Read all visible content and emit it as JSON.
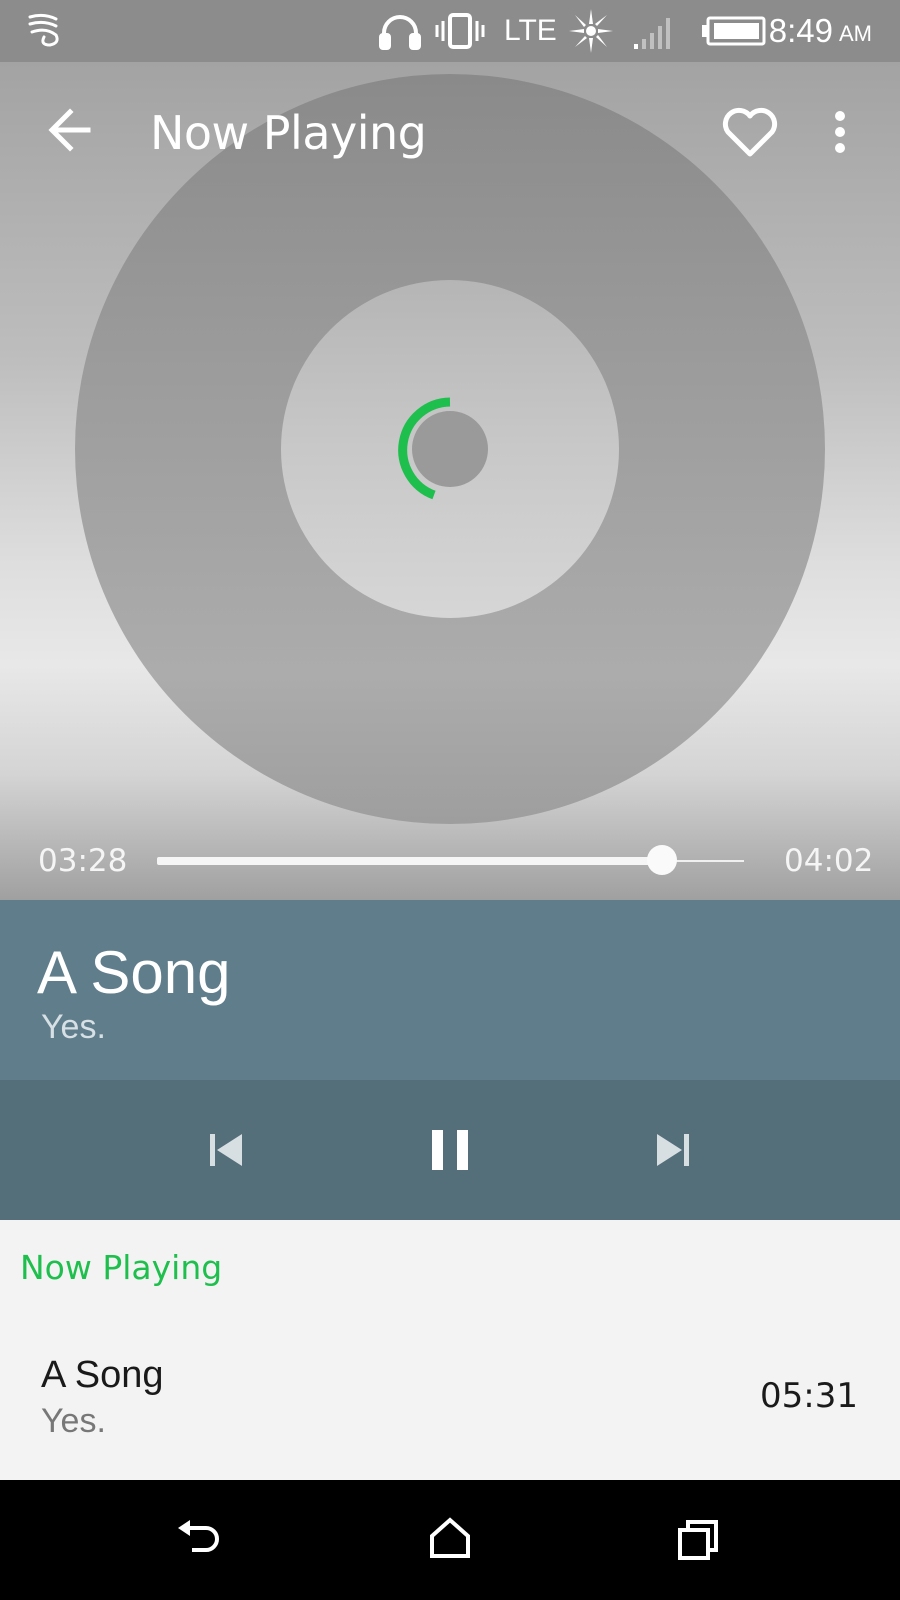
{
  "status_bar": {
    "network_type": "LTE",
    "time": "8:49",
    "ampm": "AM",
    "icons": [
      "notification-swirl-icon",
      "headphones-icon",
      "vibrate-icon",
      "brightness-icon",
      "signal-icon",
      "battery-icon"
    ]
  },
  "app_bar": {
    "title": "Now Playing",
    "back_icon": "arrow-left-icon",
    "favorite_icon": "heart-outline-icon",
    "more_icon": "more-vert-icon"
  },
  "player": {
    "elapsed": "03:28",
    "total": "04:02",
    "progress": 0.8595,
    "song_title": "A Song",
    "artist": "Yes.",
    "controls": {
      "previous_icon": "skip-previous-icon",
      "pause_icon": "pause-icon",
      "next_icon": "skip-next-icon"
    }
  },
  "queue": {
    "header": "Now Playing",
    "items": [
      {
        "title": "A Song",
        "artist": "Yes.",
        "duration": "05:31"
      }
    ]
  },
  "nav_bar": {
    "icons": [
      "back-nav-icon",
      "home-nav-icon",
      "recents-nav-icon"
    ]
  },
  "colors": {
    "accent": "#1fbf4e",
    "info_panel": "#607d8b",
    "controls_panel": "#546e7a"
  }
}
